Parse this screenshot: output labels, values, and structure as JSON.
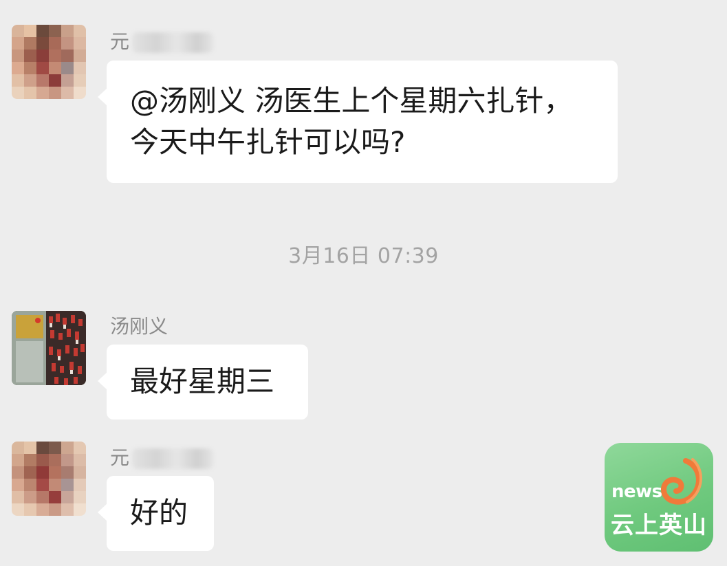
{
  "messages": [
    {
      "sender_visible": "元",
      "text_lines": [
        "@汤刚义  汤医生上个星期六扎针，",
        "今天中午扎针可以吗?"
      ]
    },
    {
      "sender_visible": "汤刚义",
      "text_lines": [
        "最好星期三"
      ]
    },
    {
      "sender_visible": "元",
      "text_lines": [
        "好的"
      ]
    }
  ],
  "timestamp": "3月16日 07:39",
  "watermark": {
    "small_text": "news",
    "brand_text": "云上英山",
    "bg_color": "#6fc97e",
    "accent_color": "#f07a3a"
  },
  "avatar_icons": [
    "pixelated-avatar-icon",
    "photo-avatar-icon",
    "pixelated-avatar-icon"
  ]
}
